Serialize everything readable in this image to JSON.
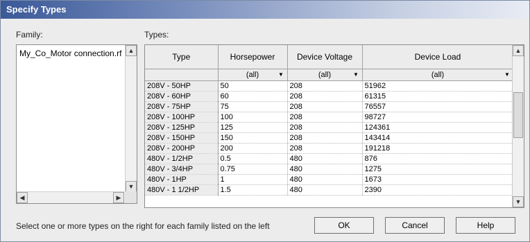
{
  "window": {
    "title": "Specify Types"
  },
  "family": {
    "label": "Family:",
    "items": [
      "My_Co_Motor connection.rfa"
    ]
  },
  "types": {
    "label": "Types:",
    "columns": [
      "Type",
      "Horsepower",
      "Device Voltage",
      "Device Load"
    ],
    "filters": [
      "(all)",
      "(all)",
      "(all)"
    ],
    "rows": [
      [
        "208V - 50HP",
        "50",
        "208",
        "51962"
      ],
      [
        "208V - 60HP",
        "60",
        "208",
        "61315"
      ],
      [
        "208V - 75HP",
        "75",
        "208",
        "76557"
      ],
      [
        "208V - 100HP",
        "100",
        "208",
        "98727"
      ],
      [
        "208V - 125HP",
        "125",
        "208",
        "124361"
      ],
      [
        "208V - 150HP",
        "150",
        "208",
        "143414"
      ],
      [
        "208V - 200HP",
        "200",
        "208",
        "191218"
      ],
      [
        "480V - 1/2HP",
        "0.5",
        "480",
        "876"
      ],
      [
        "480V - 3/4HP",
        "0.75",
        "480",
        "1275"
      ],
      [
        "480V - 1HP",
        "1",
        "480",
        "1673"
      ],
      [
        "480V - 1 1/2HP",
        "1.5",
        "480",
        "2390"
      ]
    ]
  },
  "footer": {
    "hint": "Select one or more types on the right for each family listed on the left",
    "ok_label": "OK",
    "cancel_label": "Cancel",
    "help_label": "Help"
  },
  "icons": {
    "dropdown": "triangle-down-icon",
    "scroll_up": "triangle-up-icon",
    "scroll_down": "triangle-down-icon",
    "scroll_left": "triangle-left-icon",
    "scroll_right": "triangle-right-icon"
  }
}
